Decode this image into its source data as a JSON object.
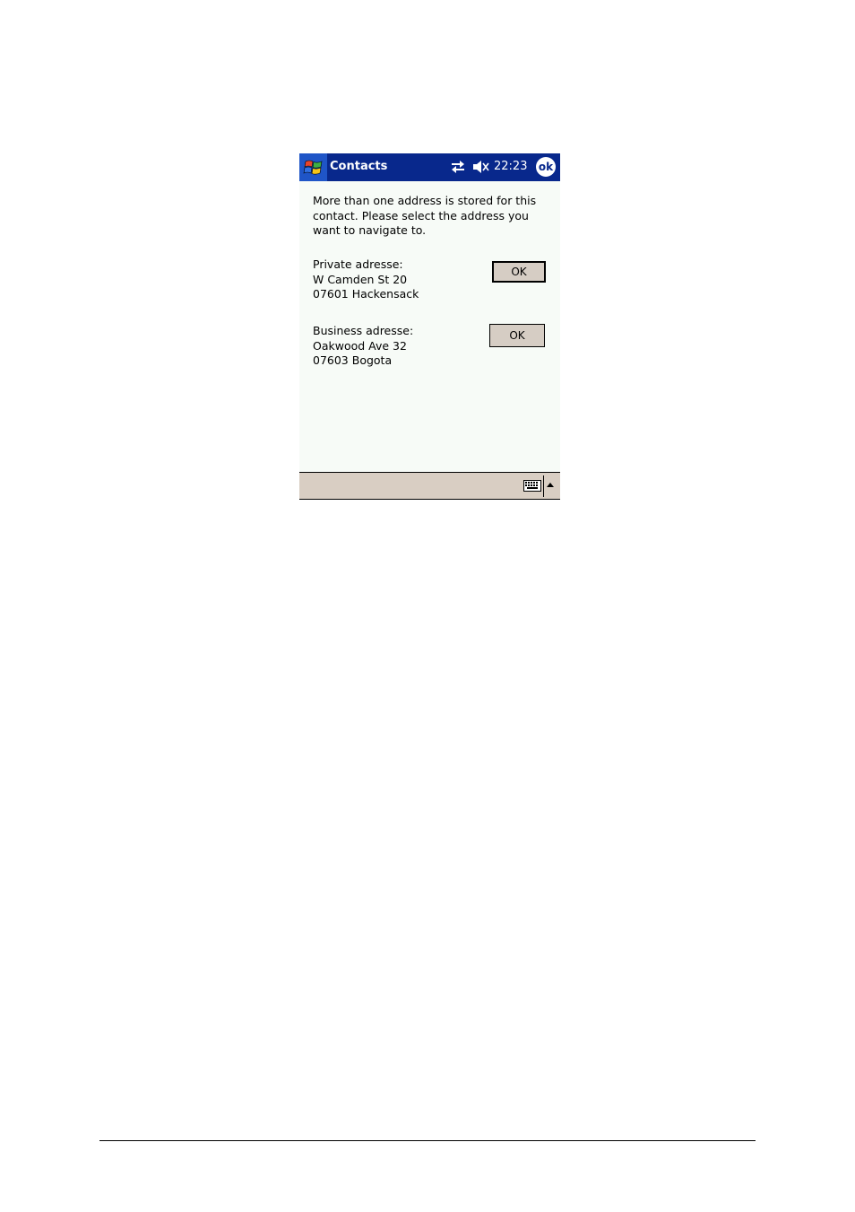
{
  "titlebar": {
    "start_icon": "windows-flag-icon",
    "app_title": "Contacts",
    "connectivity_icon": "connectivity-arrows-icon",
    "speaker_icon": "speaker-muted-icon",
    "time": "22:23",
    "ok_label": "ok"
  },
  "dialog": {
    "intro_text": "More than one address is stored for this\ncontact. Please select the address you\nwant to navigate to.",
    "private": {
      "label": "Private adresse:",
      "street": "W Camden St 20",
      "city": "07601 Hackensack",
      "button_label": "OK"
    },
    "business": {
      "label": "Business adresse:",
      "street": "Oakwood Ave 32",
      "city": "07603 Bogota",
      "button_label": "OK"
    }
  },
  "bottombar": {
    "keyboard_icon": "keyboard-icon",
    "sip_arrow_icon": "up-arrow-icon"
  },
  "colors": {
    "titlebar": "#08288c",
    "background": "#f7fbf7",
    "button": "#d6cdc4",
    "bottombar": "#d9cec3"
  }
}
